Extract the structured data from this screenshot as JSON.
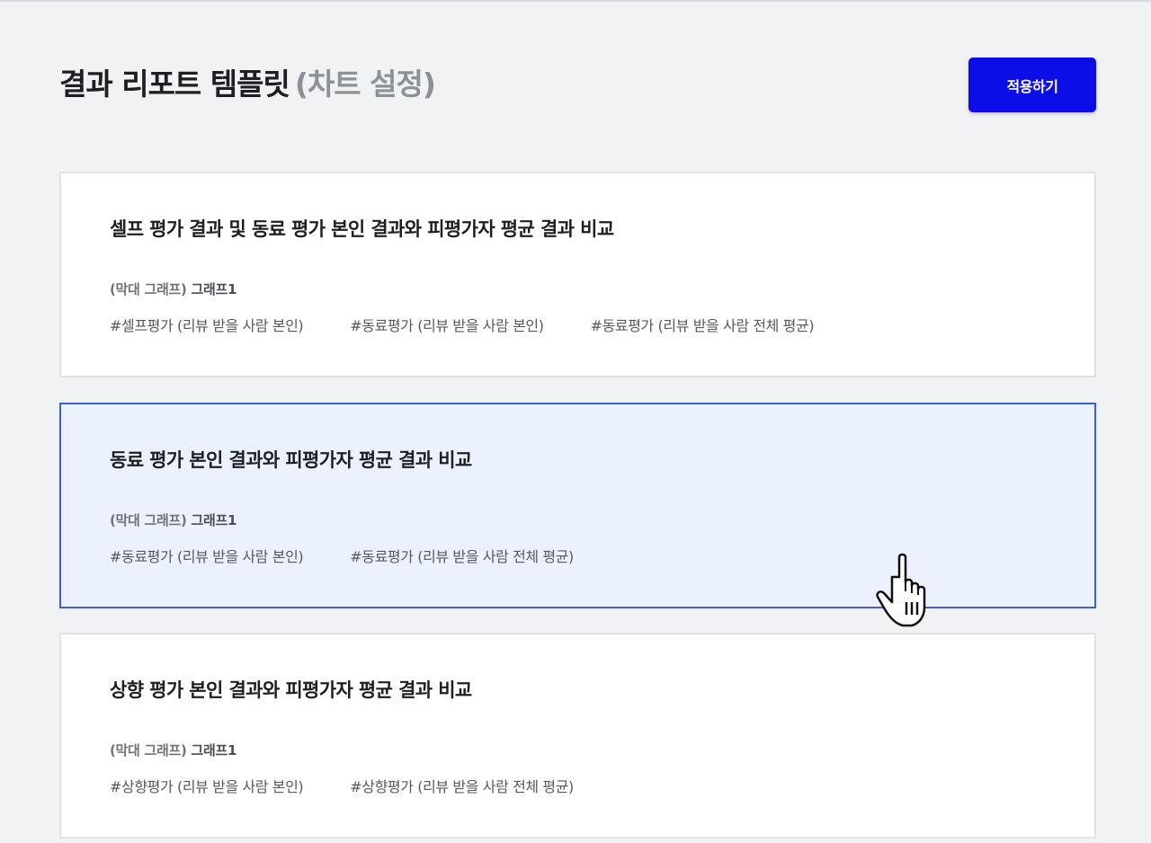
{
  "header": {
    "title": "결과 리포트 템플릿",
    "subtitle": "(차트 설정)",
    "apply_label": "적용하기"
  },
  "cards": [
    {
      "title": "셀프 평가 결과 및 동료 평가 본인 결과와 피평가자 평균 결과 비교",
      "chart_type": "(막대 그래프)",
      "graph_name": "그래프1",
      "tags": [
        "#셀프평가 (리뷰 받을 사람 본인)",
        "#동료평가 (리뷰 받을 사람 본인)",
        "#동료평가 (리뷰 받을 사람 전체 평균)"
      ],
      "selected": false
    },
    {
      "title": "동료 평가 본인 결과와 피평가자 평균 결과 비교",
      "chart_type": "(막대 그래프)",
      "graph_name": "그래프1",
      "tags": [
        "#동료평가 (리뷰 받을 사람 본인)",
        "#동료평가 (리뷰 받을 사람 전체 평균)"
      ],
      "selected": true
    },
    {
      "title": "상향 평가 본인 결과와 피평가자 평균 결과 비교",
      "chart_type": "(막대 그래프)",
      "graph_name": "그래프1",
      "tags": [
        "#상향평가 (리뷰 받을 사람 본인)",
        "#상향평가 (리뷰 받을 사람 전체 평균)"
      ],
      "selected": false
    }
  ],
  "colors": {
    "accent": "#0b0ee6",
    "selected_bg": "#ebf1fe",
    "selected_border": "#3f5ed8"
  },
  "icons": {
    "cursor": "hand-pointer-icon"
  }
}
